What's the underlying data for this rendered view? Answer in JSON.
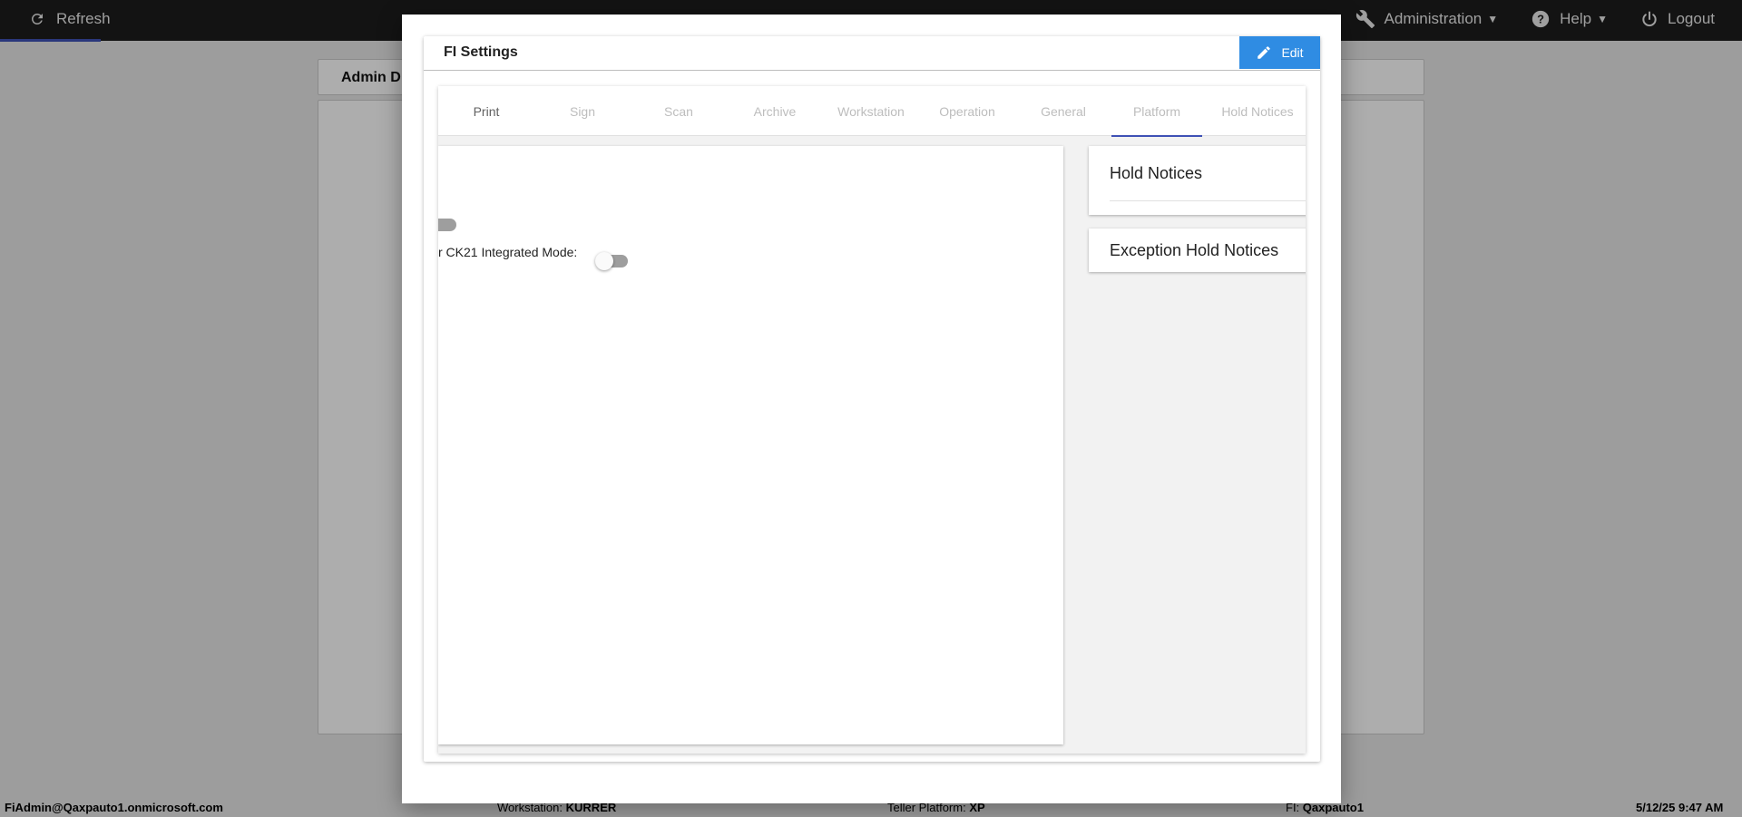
{
  "topbar": {
    "refresh_label": "Refresh",
    "nav": {
      "administration": "Administration",
      "help": "Help",
      "logout": "Logout"
    }
  },
  "background": {
    "header_title": "Admin D"
  },
  "footer": {
    "user": "FiAdmin@Qaxpauto1.onmicrosoft.com",
    "workstation_label": "Workstation:",
    "workstation_value": "KURRER",
    "teller_label": "Teller Platform:",
    "teller_value": "XP",
    "fi_label": "FI:",
    "fi_value": "Qaxpauto1",
    "datetime": "5/12/25 9:47 AM"
  },
  "modal": {
    "title": "FI Settings",
    "edit_label": "Edit",
    "tabs": [
      {
        "label": "Print"
      },
      {
        "label": "Sign"
      },
      {
        "label": "Scan"
      },
      {
        "label": "Archive"
      },
      {
        "label": "Workstation"
      },
      {
        "label": "Operation"
      },
      {
        "label": "General"
      },
      {
        "label": "Platform"
      },
      {
        "label": "Hold Notices"
      }
    ],
    "active_tab": "Platform",
    "settings": {
      "ck21_label": "r CK21 Integrated Mode:",
      "ck21_enabled": false,
      "upper_toggle_enabled": false
    },
    "side_cards": {
      "hold_notices": "Hold Notices",
      "exception_hold_notices": "Exception Hold Notices"
    }
  },
  "colors": {
    "accent": "#3f51b5",
    "edit_button": "#2f8ce3",
    "topbar": "#1c1c1c"
  }
}
